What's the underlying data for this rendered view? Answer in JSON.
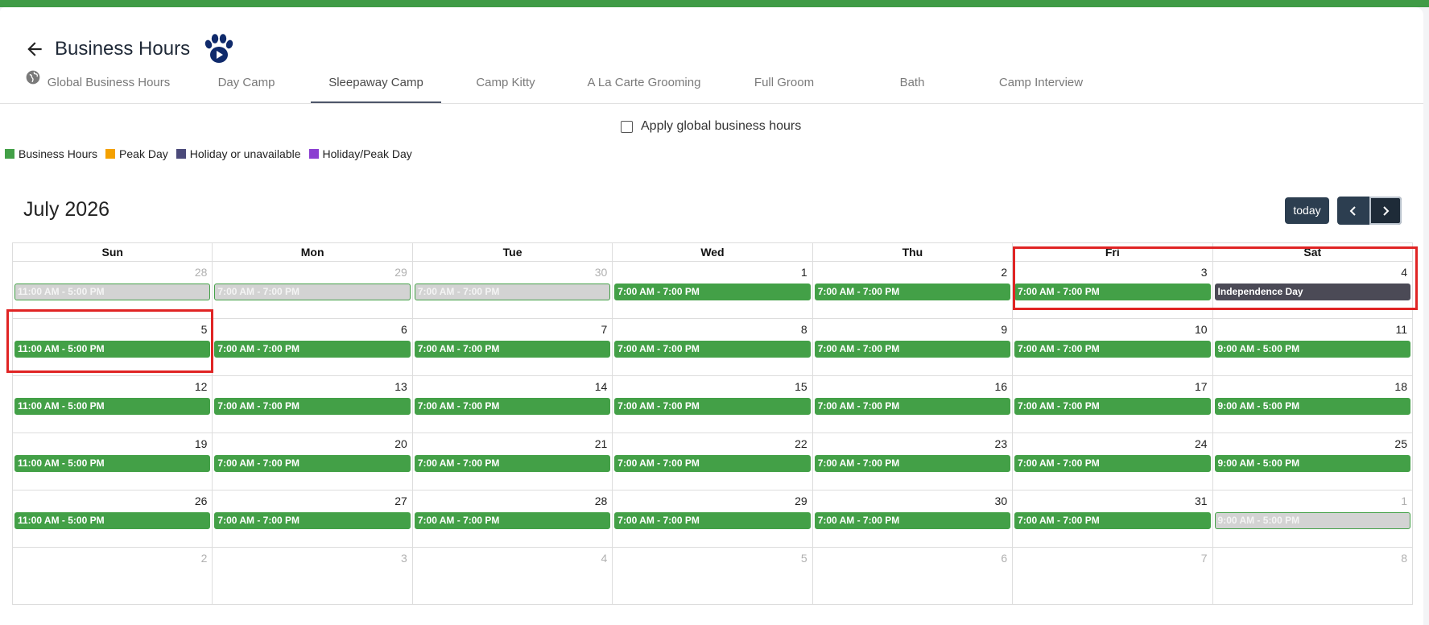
{
  "header": {
    "title": "Business Hours",
    "back_icon": "arrow-left-icon",
    "logo_icon": "paw-play-icon"
  },
  "tabs": [
    {
      "label": "Global Business Hours",
      "icon": "globe-icon"
    },
    {
      "label": "Day Camp"
    },
    {
      "label": "Sleepaway Camp",
      "active": true
    },
    {
      "label": "Camp Kitty"
    },
    {
      "label": "A La Carte Grooming"
    },
    {
      "label": "Full Groom"
    },
    {
      "label": "Bath"
    },
    {
      "label": "Camp Interview"
    }
  ],
  "apply_global": {
    "label": "Apply global business hours",
    "checked": false
  },
  "legend": [
    {
      "label": "Business Hours",
      "color": "#43a047"
    },
    {
      "label": "Peak Day",
      "color": "#f4a100"
    },
    {
      "label": "Holiday or unavailable",
      "color": "#4b4a7a"
    },
    {
      "label": "Holiday/Peak Day",
      "color": "#8b3fd1"
    }
  ],
  "calendar": {
    "title": "July 2026",
    "today_label": "today",
    "weekdays": [
      "Sun",
      "Mon",
      "Tue",
      "Wed",
      "Thu",
      "Fri",
      "Sat"
    ],
    "weeks": [
      [
        {
          "day": "28",
          "other": true,
          "event": "11:00 AM - 5:00 PM",
          "style": "grey"
        },
        {
          "day": "29",
          "other": true,
          "event": "7:00 AM - 7:00 PM",
          "style": "grey"
        },
        {
          "day": "30",
          "other": true,
          "event": "7:00 AM - 7:00 PM",
          "style": "grey"
        },
        {
          "day": "1",
          "event": "7:00 AM - 7:00 PM",
          "style": "green"
        },
        {
          "day": "2",
          "event": "7:00 AM - 7:00 PM",
          "style": "green"
        },
        {
          "day": "3",
          "event": "7:00 AM - 7:00 PM",
          "style": "green"
        },
        {
          "day": "4",
          "event": "Independence Day",
          "style": "dark"
        }
      ],
      [
        {
          "day": "5",
          "event": "11:00 AM - 5:00 PM",
          "style": "green"
        },
        {
          "day": "6",
          "event": "7:00 AM - 7:00 PM",
          "style": "green"
        },
        {
          "day": "7",
          "event": "7:00 AM - 7:00 PM",
          "style": "green"
        },
        {
          "day": "8",
          "event": "7:00 AM - 7:00 PM",
          "style": "green"
        },
        {
          "day": "9",
          "event": "7:00 AM - 7:00 PM",
          "style": "green"
        },
        {
          "day": "10",
          "event": "7:00 AM - 7:00 PM",
          "style": "green"
        },
        {
          "day": "11",
          "event": "9:00 AM - 5:00 PM",
          "style": "green"
        }
      ],
      [
        {
          "day": "12",
          "event": "11:00 AM - 5:00 PM",
          "style": "green"
        },
        {
          "day": "13",
          "event": "7:00 AM - 7:00 PM",
          "style": "green"
        },
        {
          "day": "14",
          "event": "7:00 AM - 7:00 PM",
          "style": "green"
        },
        {
          "day": "15",
          "event": "7:00 AM - 7:00 PM",
          "style": "green"
        },
        {
          "day": "16",
          "event": "7:00 AM - 7:00 PM",
          "style": "green"
        },
        {
          "day": "17",
          "event": "7:00 AM - 7:00 PM",
          "style": "green"
        },
        {
          "day": "18",
          "event": "9:00 AM - 5:00 PM",
          "style": "green"
        }
      ],
      [
        {
          "day": "19",
          "event": "11:00 AM - 5:00 PM",
          "style": "green"
        },
        {
          "day": "20",
          "event": "7:00 AM - 7:00 PM",
          "style": "green"
        },
        {
          "day": "21",
          "event": "7:00 AM - 7:00 PM",
          "style": "green"
        },
        {
          "day": "22",
          "event": "7:00 AM - 7:00 PM",
          "style": "green"
        },
        {
          "day": "23",
          "event": "7:00 AM - 7:00 PM",
          "style": "green"
        },
        {
          "day": "24",
          "event": "7:00 AM - 7:00 PM",
          "style": "green"
        },
        {
          "day": "25",
          "event": "9:00 AM - 5:00 PM",
          "style": "green"
        }
      ],
      [
        {
          "day": "26",
          "event": "11:00 AM - 5:00 PM",
          "style": "green"
        },
        {
          "day": "27",
          "event": "7:00 AM - 7:00 PM",
          "style": "green"
        },
        {
          "day": "28",
          "event": "7:00 AM - 7:00 PM",
          "style": "green"
        },
        {
          "day": "29",
          "event": "7:00 AM - 7:00 PM",
          "style": "green"
        },
        {
          "day": "30",
          "event": "7:00 AM - 7:00 PM",
          "style": "green"
        },
        {
          "day": "31",
          "event": "7:00 AM - 7:00 PM",
          "style": "green"
        },
        {
          "day": "1",
          "other": true,
          "event": "9:00 AM - 5:00 PM",
          "style": "grey"
        }
      ],
      [
        {
          "day": "2",
          "other": true
        },
        {
          "day": "3",
          "other": true
        },
        {
          "day": "4",
          "other": true
        },
        {
          "day": "5",
          "other": true
        },
        {
          "day": "6",
          "other": true
        },
        {
          "day": "7",
          "other": true
        },
        {
          "day": "8",
          "other": true
        }
      ]
    ]
  },
  "colors": {
    "accent_green": "#3f9b46",
    "nav_dark": "#2c3e50",
    "highlight_red": "#e02424"
  }
}
